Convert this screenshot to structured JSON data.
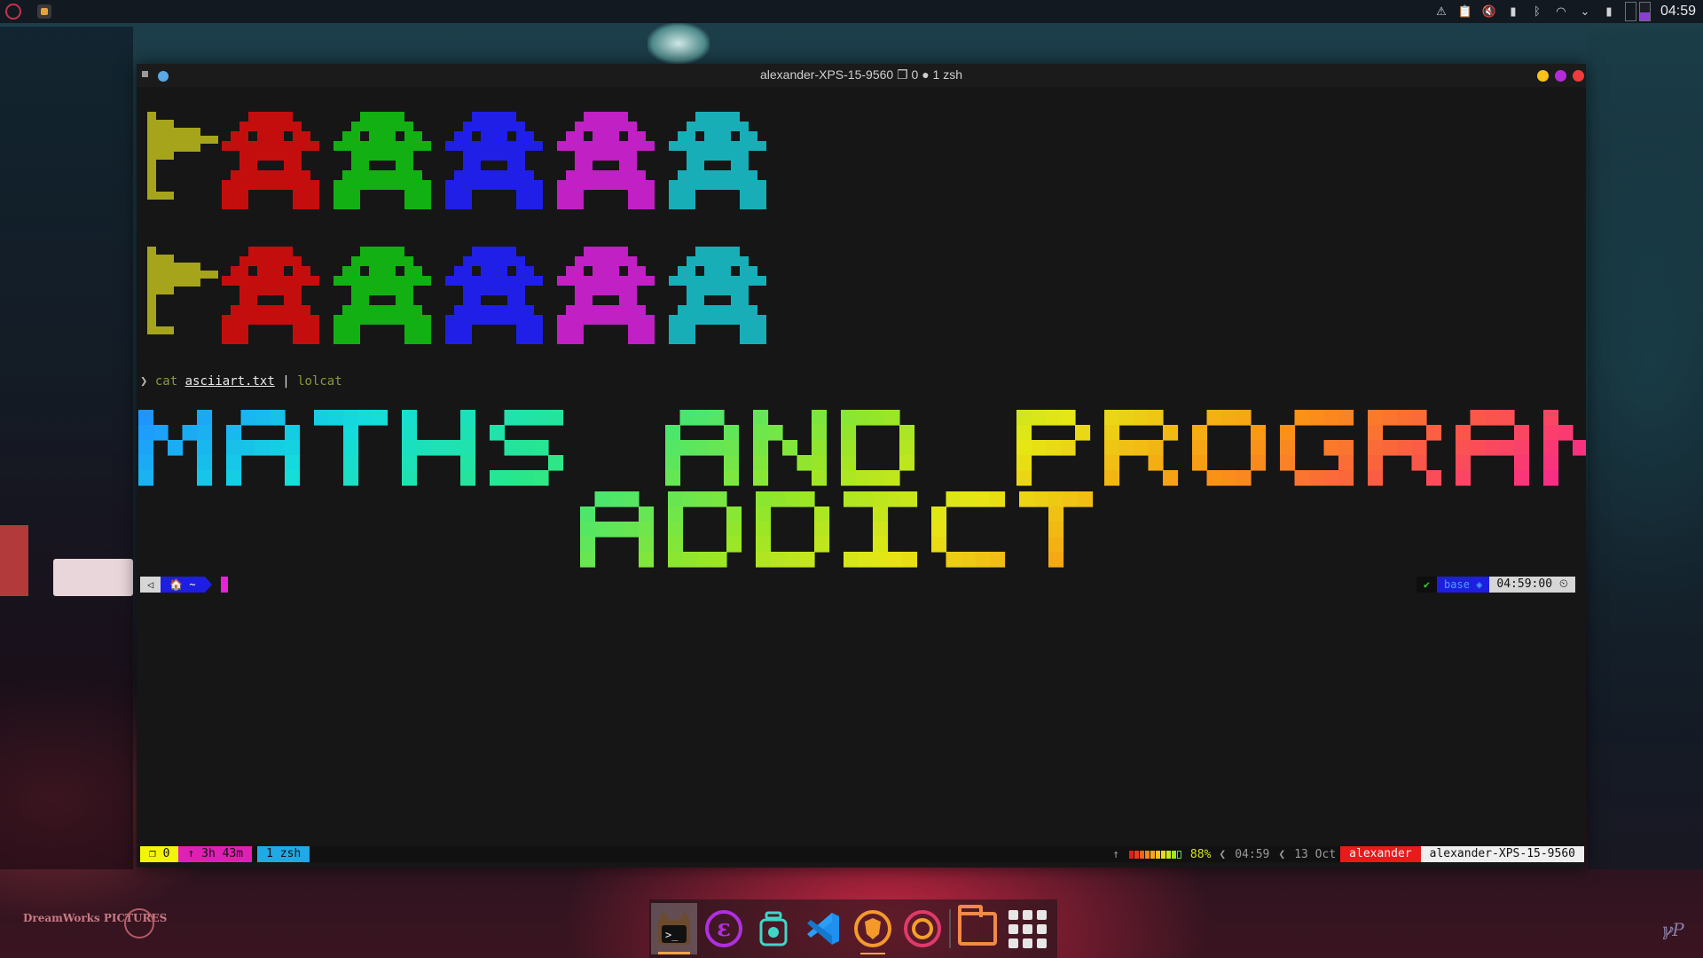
{
  "top_panel": {
    "clock": "04:59",
    "tray_icons": [
      "notification-icon",
      "clipboard-icon",
      "volume-muted-icon",
      "battery-icon",
      "bluetooth-icon",
      "wifi-icon",
      "expand-icon",
      "battery-charge-icon"
    ],
    "pager_active_index": 1,
    "pager_count": 2
  },
  "window": {
    "title": "alexander-XPS-15-9560 ❐ 0 ● 1 zsh"
  },
  "terminal": {
    "invader_colors": [
      "#a6a41b",
      "#c40e0e",
      "#12b012",
      "#1f1fe8",
      "#c020c4",
      "#18aeb8"
    ],
    "prompt": {
      "arrow": "❯",
      "command": "cat",
      "file": "asciiart.txt",
      "pipe": "|",
      "program": "lolcat"
    },
    "banner_lines": [
      "MATHS AND PROGRAMMING",
      "ADDICT"
    ],
    "p10k_left": {
      "os_icon": "◁",
      "dir": "🏠 ~"
    },
    "p10k_right": {
      "status": "✔",
      "env": "base ◈",
      "time": "04:59:00 ⏲"
    }
  },
  "tmux": {
    "session": "❐ 0",
    "uptime": "↑ 3h 43m",
    "window": "1 zsh",
    "up_arrow": "↑",
    "battery_pct": "88%",
    "battery_level": 0.88,
    "time": "04:59",
    "date": "13 Oct",
    "sep": "❮",
    "user": "alexander",
    "host": "alexander-XPS-15-9560"
  },
  "dock": {
    "items": [
      "konsole-terminal-icon",
      "emacs-icon",
      "bug-tracker-icon",
      "vscode-icon",
      "brave-browser-icon",
      "firefox-icon",
      "file-manager-icon",
      "app-grid-icon"
    ]
  },
  "wallpaper": {
    "logo_text": "DreamWorks PICTURES"
  }
}
